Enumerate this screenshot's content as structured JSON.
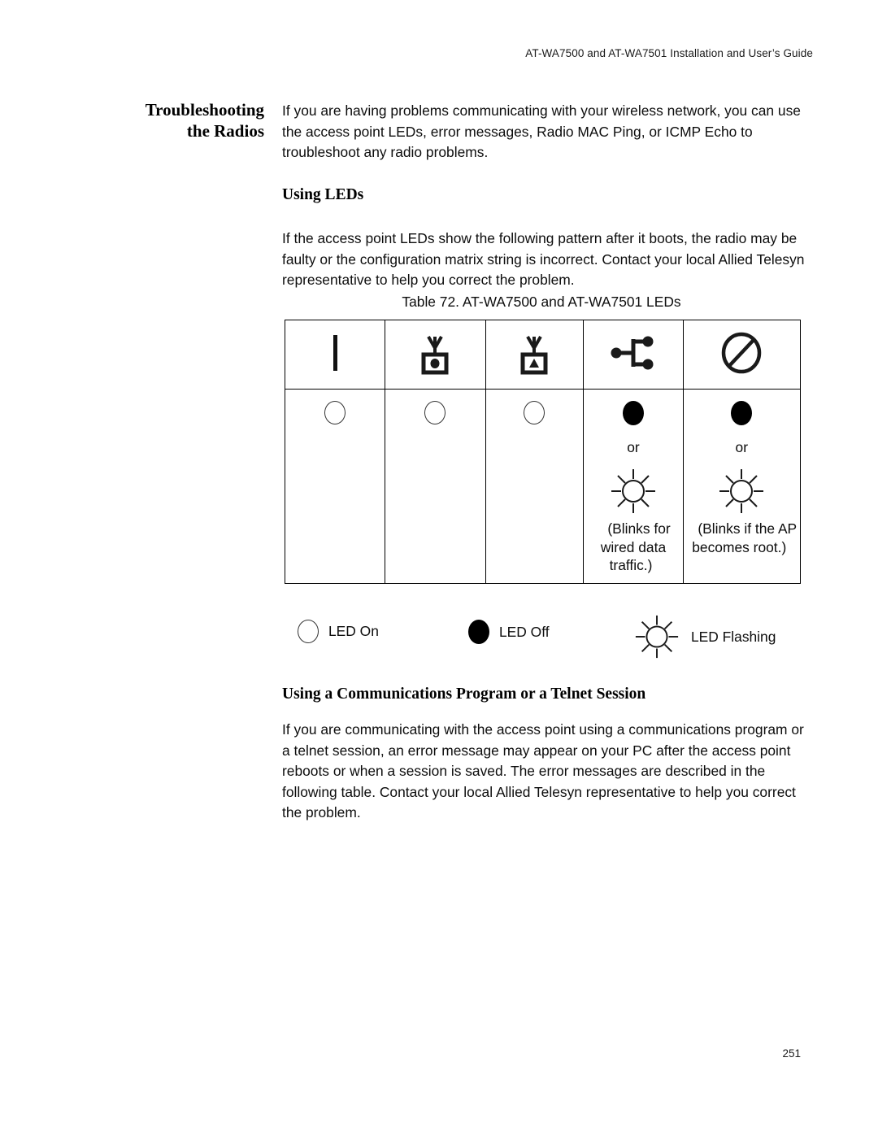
{
  "header": {
    "running_head": "AT-WA7500 and AT-WA7501 Installation and User’s Guide"
  },
  "section": {
    "title_line1": "Troubleshooting",
    "title_line2": "the Radios",
    "intro_paragraph": "If you are having problems communicating with your wireless network, you can use the access point LEDs, error messages, Radio MAC Ping, or ICMP Echo to troubleshoot any radio problems."
  },
  "using_leds": {
    "heading": "Using LEDs",
    "paragraph": "If the access point LEDs show the following pattern after it boots, the radio may be faulty or the configuration matrix string is incorrect. Contact your local Allied Telesyn representative to help you correct the problem."
  },
  "table": {
    "caption": "Table 72. AT-WA7500 and AT-WA7501 LEDs",
    "columns": [
      {
        "icon": "power-bar-icon",
        "state": "on",
        "note": ""
      },
      {
        "icon": "radio-dot-icon",
        "state": "on",
        "note": ""
      },
      {
        "icon": "radio-triangle-icon",
        "state": "on",
        "note": ""
      },
      {
        "icon": "network-branch-icon",
        "state": "off-or-flashing",
        "note": "(Blinks for wired data traffic.)"
      },
      {
        "icon": "circle-slash-icon",
        "state": "off-or-flashing",
        "note": "(Blinks if the AP becomes root.)"
      }
    ],
    "or_label": "or"
  },
  "legend": {
    "items": [
      {
        "icon": "led-on-icon",
        "label": "LED On"
      },
      {
        "icon": "led-off-icon",
        "label": "LED Off"
      },
      {
        "icon": "led-flashing-icon",
        "label": "LED Flashing"
      }
    ]
  },
  "comm_section": {
    "heading": "Using a Communications Program or a Telnet Session",
    "paragraph": "If you are communicating with the access point using a communications program or a telnet session, an error message may appear on your PC after the access point reboots or when a session is saved. The error messages are described in the following table. Contact your local Allied Telesyn representative to help you correct the problem."
  },
  "footer": {
    "page_number": "251"
  },
  "colors": {
    "ink": "#000000",
    "paper": "#ffffff"
  }
}
